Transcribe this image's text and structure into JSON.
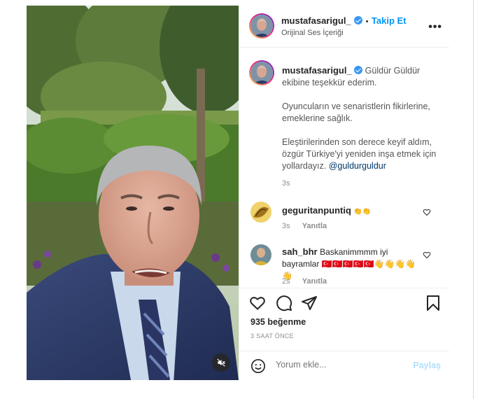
{
  "header": {
    "username": "mustafasarigul_",
    "separator": "•",
    "follow_label": "Takip Et",
    "audio_label": "Orijinal Ses İçeriği",
    "more_icon": "more-horizontal-icon"
  },
  "caption": {
    "username": "mustafasarigul_",
    "line1": "Güldür Güldür",
    "line2": "ekibine teşekkür ederim.",
    "para2": "Oyuncuların ve senaristlerin fikirlerine, emeklerine sağlık.",
    "para3": "Eleştirilerinden son derece keyif aldım, özgür Türkiye'yi yeniden inşa etmek için yollardayız.",
    "mention": "@guldurguldur",
    "time": "3s"
  },
  "comments": [
    {
      "username": "geguritanpuntiq",
      "text": "👏👏",
      "time": "3s",
      "reply_label": "Yanıtla"
    },
    {
      "username": "sah_bhr",
      "text": "Baskanimmmm iyi bayramlar 🇹🇷🇹🇷🇹🇷🇹🇷🇹🇷👋👋👋👋👋",
      "time": "2s",
      "reply_label": "Yanıtla"
    }
  ],
  "actions": {
    "like_icon": "heart-icon",
    "comment_icon": "comment-icon",
    "share_icon": "share-icon",
    "save_icon": "bookmark-icon"
  },
  "likes_label": "935 beğenme",
  "time_label": "3 SAAT ÖNCE",
  "add_comment": {
    "placeholder": "Yorum ekle...",
    "post_label": "Paylaş",
    "emoji_icon": "emoji-icon"
  },
  "media": {
    "mute_icon": "muted-speaker-icon"
  },
  "colors": {
    "accent": "#0095f6",
    "text": "#262626",
    "muted": "#8e8e8e",
    "verified": "#3897f0"
  }
}
